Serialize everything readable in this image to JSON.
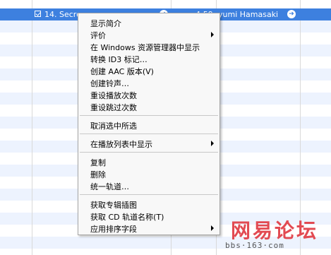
{
  "selected_track": {
    "title": "14. Secre",
    "time": "4:59",
    "artist": "yumi Hamasaki"
  },
  "context_menu": {
    "groups": [
      [
        {
          "label": "显示简介"
        },
        {
          "label": "评价",
          "submenu": true
        },
        {
          "label": "在 Windows 资源管理器中显示"
        },
        {
          "label": "转换 ID3 标记…"
        },
        {
          "label": "创建 AAC 版本(V)"
        },
        {
          "label": "创建铃声…"
        },
        {
          "label": "重设播放次数"
        },
        {
          "label": "重设跳过次数"
        }
      ],
      [
        {
          "label": "取消选中所选"
        }
      ],
      [
        {
          "label": "在播放列表中显示",
          "submenu": true
        }
      ],
      [
        {
          "label": "复制"
        },
        {
          "label": "删除"
        },
        {
          "label": "统一轨道…"
        }
      ],
      [
        {
          "label": "获取专辑插图"
        },
        {
          "label": "获取 CD 轨道名称(T)"
        },
        {
          "label": "应用排序字段",
          "submenu": true
        }
      ]
    ]
  },
  "watermark": {
    "logo_text": "网易论坛",
    "url": "bbs·163·com"
  },
  "colors": {
    "selection": "#3d80df",
    "alt_row": "#edf3fe",
    "menu_bg": "#f8f8f8",
    "watermark": "#e24a52"
  }
}
